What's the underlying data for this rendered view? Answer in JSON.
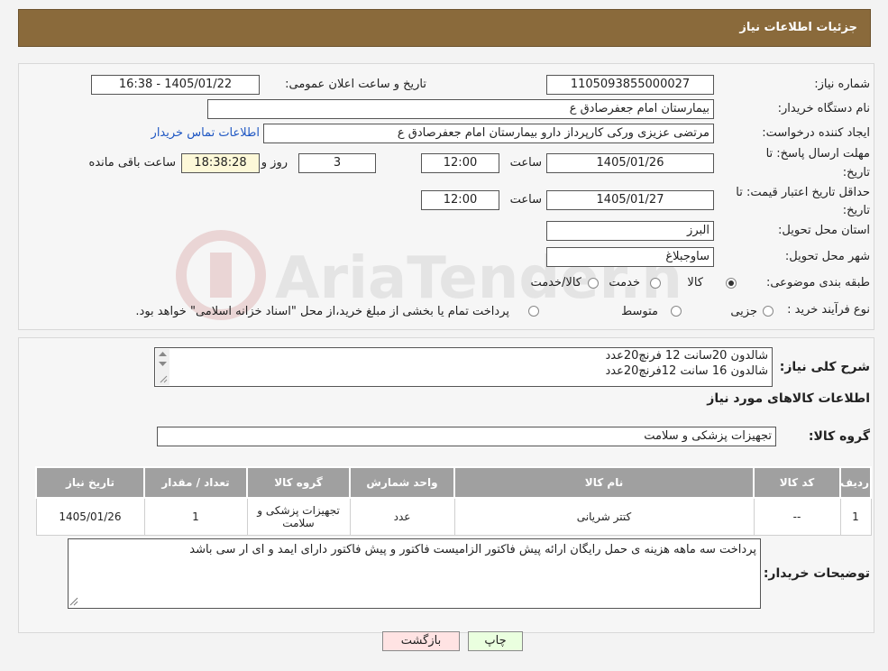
{
  "header": {
    "title": "جزئیات اطلاعات نیاز"
  },
  "fields": {
    "need_number_label": "شماره نیاز:",
    "need_number": "1105093855000027",
    "announce_label": "تاریخ و ساعت اعلان عمومی:",
    "announce_value": "1405/01/22 - 16:38",
    "buyer_org_label": "نام دستگاه خریدار:",
    "buyer_org": "بیمارستان امام جعفرصادق ع",
    "creator_label": "ایجاد کننده درخواست:",
    "creator": "مرتضی عزیزی ورکی کارپرداز دارو بیمارستان امام جعفرصادق ع",
    "contact_link": "اطلاعات تماس خریدار",
    "deadline_label_1": "مهلت ارسال پاسخ: تا",
    "deadline_label_2": "تاریخ:",
    "deadline_date": "1405/01/26",
    "time_label": "ساعت",
    "deadline_time": "12:00",
    "days_value": "3",
    "days_label": "روز و",
    "remaining_time": "18:38:28",
    "remaining_label": "ساعت باقی مانده",
    "validity_label_1": "حداقل تاریخ اعتبار قیمت: تا",
    "validity_label_2": "تاریخ:",
    "validity_date": "1405/01/27",
    "validity_time": "12:00",
    "province_label": "استان محل تحویل:",
    "province": "البرز",
    "city_label": "شهر محل تحویل:",
    "city": "ساوجبلاغ",
    "category_label": "طبقه بندی موضوعی:",
    "category_options": [
      "کالا",
      "خدمت",
      "کالا/خدمت"
    ],
    "process_label": "نوع فرآیند خرید :",
    "process_options": [
      "جزیی",
      "متوسط"
    ],
    "process_note": "پرداخت تمام یا بخشی از مبلغ خرید،از محل \"اسناد خزانه اسلامی\" خواهد بود."
  },
  "description": {
    "label": "شرح کلی نیاز:",
    "lines": [
      "شالدون 20سانت 12 فرنچ20عدد",
      "شالدون 16 سانت 12فرنچ20عدد"
    ]
  },
  "goods": {
    "section_title": "اطلاعات کالاهای مورد نیاز",
    "group_label": "گروه کالا:",
    "group_value": "تجهیزات پزشکی و سلامت",
    "columns": [
      "ردیف",
      "کد کالا",
      "نام کالا",
      "واحد شمارش",
      "گروه کالا",
      "تعداد / مقدار",
      "تاریخ نیاز"
    ],
    "rows": [
      [
        "1",
        "--",
        "کتتر شریانی",
        "عدد",
        "تجهیزات پزشکی و سلامت",
        "1",
        "1405/01/26"
      ]
    ]
  },
  "buyer_notes": {
    "label": "توضیحات خریدار:",
    "text": "پرداخت سه ماهه هزینه ی حمل رایگان ارائه پیش فاکتور الزامیست فاکتور و پیش فاکتور دارای ایمد و ای ار سی باشد"
  },
  "buttons": {
    "print": "چاپ",
    "back": "بازگشت"
  },
  "watermark": {
    "text": "AriaTender.neT"
  },
  "colors": {
    "header_bg": "#8a6a3b",
    "print_btn": "#eaffdf",
    "back_btn": "#ffe3e3",
    "link": "#1f57c3"
  }
}
